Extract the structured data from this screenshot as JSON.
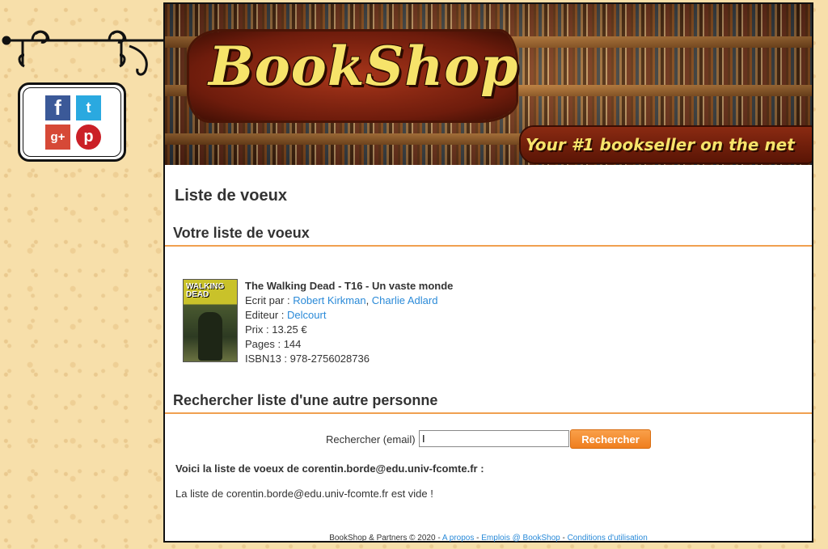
{
  "social": {
    "facebook": "f",
    "twitter": "t",
    "googleplus": "g+",
    "pinterest": "p"
  },
  "banner": {
    "logo": "BookShop",
    "tagline": "Your #1 bookseller on the net"
  },
  "page_title": "Liste de voeux",
  "wishlist_section": {
    "title": "Votre liste de voeux",
    "book": {
      "cover_text": "WALKING DEAD",
      "title": "The Walking Dead - T16 - Un vaste monde",
      "author_label": "Ecrit par : ",
      "author1": "Robert Kirkman",
      "author_sep": ", ",
      "author2": "Charlie Adlard",
      "publisher_label": "Editeur : ",
      "publisher": "Delcourt",
      "price": "Prix : 13.25 €",
      "pages": "Pages : 144",
      "isbn": "ISBN13 : 978-2756028736"
    }
  },
  "search_section": {
    "title": "Rechercher liste d'une autre personne",
    "label": "Rechercher (email)",
    "input_value": "I",
    "button": "Rechercher",
    "result_heading": "Voici la liste de voeux de corentin.borde@edu.univ-fcomte.fr :",
    "result_text": "La liste de corentin.borde@edu.univ-fcomte.fr est vide !"
  },
  "footer": {
    "copyright": "BookShop & Partners © 2020 - ",
    "link_about": "A propos",
    "sep1": " - ",
    "link_jobs": "Emplois @ BookShop",
    "sep2": " - ",
    "link_terms": "Conditions d'utilisation"
  }
}
